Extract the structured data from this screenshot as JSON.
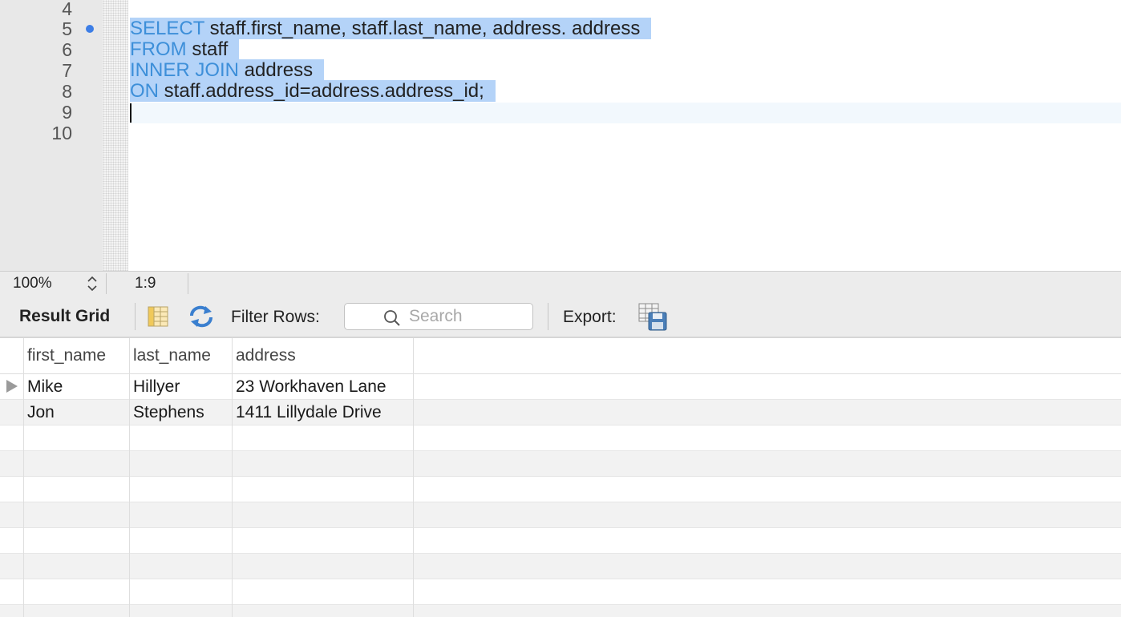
{
  "editor": {
    "lines": [
      {
        "num": "4"
      },
      {
        "num": "5",
        "keyword": "SELECT",
        "text": " staff.first_name, staff.last_name, address. address"
      },
      {
        "num": "6",
        "keyword": "FROM",
        "text": " staff"
      },
      {
        "num": "7",
        "keyword": "INNER JOIN",
        "text": " address"
      },
      {
        "num": "8",
        "keyword": "ON",
        "text": " staff.address_id=address.address_id;"
      },
      {
        "num": "9"
      },
      {
        "num": "10"
      }
    ],
    "colors": {
      "keyword": "#3d8fd9",
      "selection": "#b4d3f8",
      "marker": "#3d7ee6"
    }
  },
  "status": {
    "zoom": "100%",
    "cursor_position": "1:9"
  },
  "toolbar": {
    "title": "Result Grid",
    "grid_icon": "form-editor-icon",
    "refresh_icon": "refresh-icon",
    "filter_label": "Filter Rows:",
    "search_placeholder": "Search",
    "export_label": "Export:",
    "export_icon": "export-save-icon"
  },
  "grid": {
    "columns": [
      "first_name",
      "last_name",
      "address"
    ],
    "rows": [
      [
        "Mike",
        "Hillyer",
        "23 Workhaven Lane"
      ],
      [
        "Jon",
        "Stephens",
        "1411 Lillydale Drive"
      ]
    ]
  }
}
